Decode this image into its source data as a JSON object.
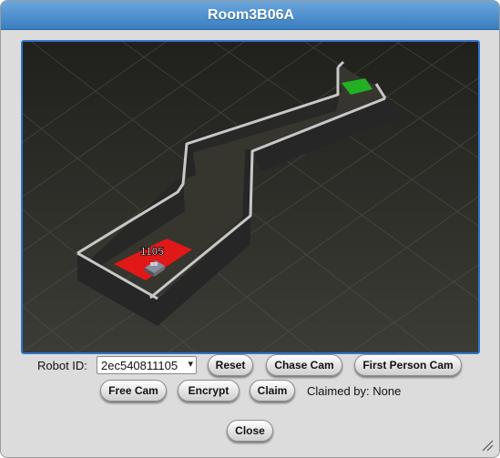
{
  "window": {
    "title": "Room3B06A"
  },
  "scene": {
    "robot_label": "1105",
    "start_tile_color": "#e01818",
    "goal_tile_color": "#22b022",
    "wall_color": "#2a2a2a",
    "wall_top_color": "#c8c8c8",
    "floor_color": "#3a3a34"
  },
  "controls": {
    "robot_id_label": "Robot ID:",
    "robot_id_value": "2ec540811105",
    "reset_label": "Reset",
    "chase_cam_label": "Chase Cam",
    "first_person_cam_label": "First Person Cam",
    "free_cam_label": "Free Cam",
    "encrypt_label": "Encrypt",
    "claim_label": "Claim",
    "claimed_by_text": "Claimed by: None",
    "close_label": "Close"
  },
  "colors": {
    "title_bar": "#4a8fd0",
    "viewport_border": "#2f73c8"
  }
}
